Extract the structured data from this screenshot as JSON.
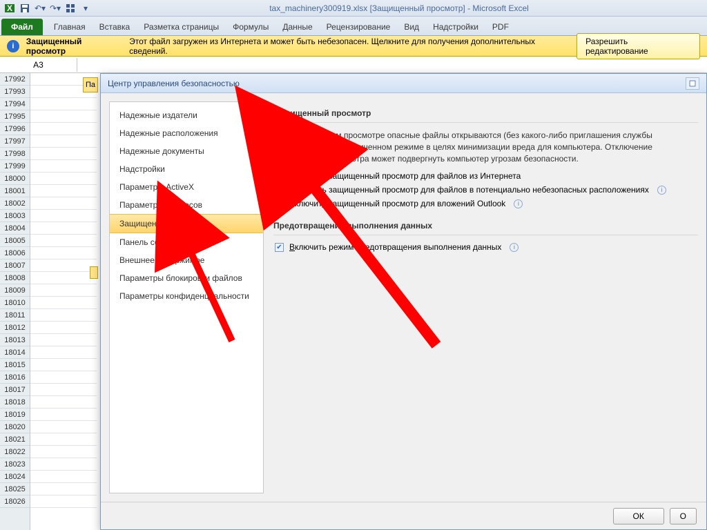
{
  "titlebar": "tax_machinery300919.xlsx  [Защищенный просмотр]  -  Microsoft Excel",
  "ribbon": {
    "file": "Файл",
    "tabs": [
      "Главная",
      "Вставка",
      "Разметка страницы",
      "Формулы",
      "Данные",
      "Рецензирование",
      "Вид",
      "Надстройки",
      "PDF"
    ]
  },
  "protected_view": {
    "label": "Защищенный просмотр",
    "msg": "Этот файл загружен из Интернета и может быть небезопасен. Щелкните для получения дополнительных сведений.",
    "enable": "Разрешить редактирование"
  },
  "namebox": "A3",
  "pa_tab": "Па",
  "rows": [
    "17992",
    "17993",
    "17994",
    "17995",
    "17996",
    "17997",
    "17998",
    "17999",
    "18000",
    "18001",
    "18002",
    "18003",
    "18004",
    "18005",
    "18006",
    "18007",
    "18008",
    "18009",
    "18010",
    "18011",
    "18012",
    "18013",
    "18014",
    "18015",
    "18016",
    "18017",
    "18018",
    "18019",
    "18020",
    "18021",
    "18022",
    "18023",
    "18024",
    "18025",
    "18026"
  ],
  "dialog": {
    "title": "Центр управления безопасностью",
    "nav": [
      "Надежные издатели",
      "Надежные расположения",
      "Надежные документы",
      "Надстройки",
      "Параметры ActiveX",
      "Параметры макросов",
      "Защищенный просмотр",
      "Панель сообщений",
      "Внешнее содержимое",
      "Параметры блокировки файлов",
      "Параметры конфиденциальности"
    ],
    "pv_section": "Защищенный просмотр",
    "pv_desc": "При защищенном просмотре опасные файлы открываются (без какого-либо приглашения службы безопасности) в ограниченном режиме в целях минимизации вреда для компьютера. Отключение защищенного просмотра может подвергнуть компьютер угрозам безопасности.",
    "chk1_pre": "В",
    "chk1_rest": "ключить защищенный просмотр для файлов из Интернета",
    "chk2": "Включить защищенный просмотр для файлов в потенциально небезопасных расположениях",
    "chk3_pre": "Включит",
    "chk3_u": "ь",
    "chk3_rest": " защищенный просмотр для вложений Outlook",
    "dep_section": "Предотвращение выполнения данных",
    "dep_pre": "В",
    "dep_rest": "ключить режим предотвращения выполнения данных",
    "ok": "ОК"
  }
}
